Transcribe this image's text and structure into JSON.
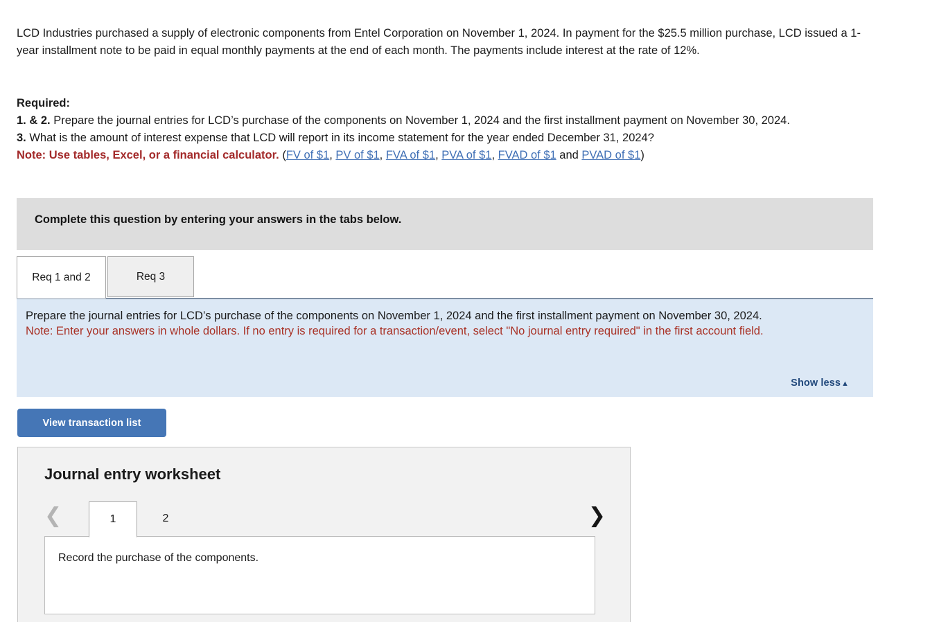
{
  "problem": {
    "text": "LCD Industries purchased a supply of electronic components from Entel Corporation on November 1, 2024. In payment for the $25.5 million purchase, LCD issued a 1-year installment note to be paid in equal monthly payments at the end of each month. The payments include interest at the rate of 12%."
  },
  "required": {
    "heading": "Required:",
    "item_1_2_label": "1. & 2.",
    "item_1_2_text": " Prepare the journal entries for LCD’s purchase of the components on November 1, 2024 and the first installment payment on November 30, 2024.",
    "item_3_label": "3.",
    "item_3_text": " What is the amount of interest expense that LCD will report in its income statement for the year ended December 31, 2024?",
    "note_label": "Note: Use tables, Excel, or a financial calculator.",
    "paren_open": " (",
    "paren_close": ")",
    "separator": ", ",
    "and_text": " and ",
    "links": [
      "FV of $1",
      "PV of $1",
      "FVA of $1",
      "PVA of $1",
      "FVAD of $1",
      "PVAD of $1"
    ]
  },
  "gray_banner": {
    "text": "Complete this question by entering your answers in the tabs below."
  },
  "tabs": [
    {
      "label": "Req 1 and 2",
      "active": true
    },
    {
      "label": "Req 3",
      "active": false
    }
  ],
  "info_panel": {
    "instruction": "Prepare the journal entries for LCD’s purchase of the components on November 1, 2024 and the first installment payment on November 30, 2024.",
    "note": "Note: Enter your answers in whole dollars. If no entry is required for a transaction/event, select \"No journal entry required\" in the first account field.",
    "show_less_label": "Show less",
    "show_less_caret": "▲"
  },
  "actions": {
    "view_transaction_list": "View transaction list"
  },
  "worksheet": {
    "title": "Journal entry worksheet",
    "prev_icon": "❮",
    "next_icon": "❯",
    "pages": [
      {
        "label": "1",
        "active": true
      },
      {
        "label": "2",
        "active": false
      }
    ],
    "record_prompt": "Record the purchase of the components."
  },
  "colors": {
    "accent_blue": "#4576b6",
    "link_blue": "#3f6fb5",
    "note_red": "#a32a2a",
    "panel_blue": "#dce8f5",
    "banner_gray": "#dddddd",
    "worksheet_gray": "#f2f2f2",
    "show_less_navy": "#234a7d"
  }
}
